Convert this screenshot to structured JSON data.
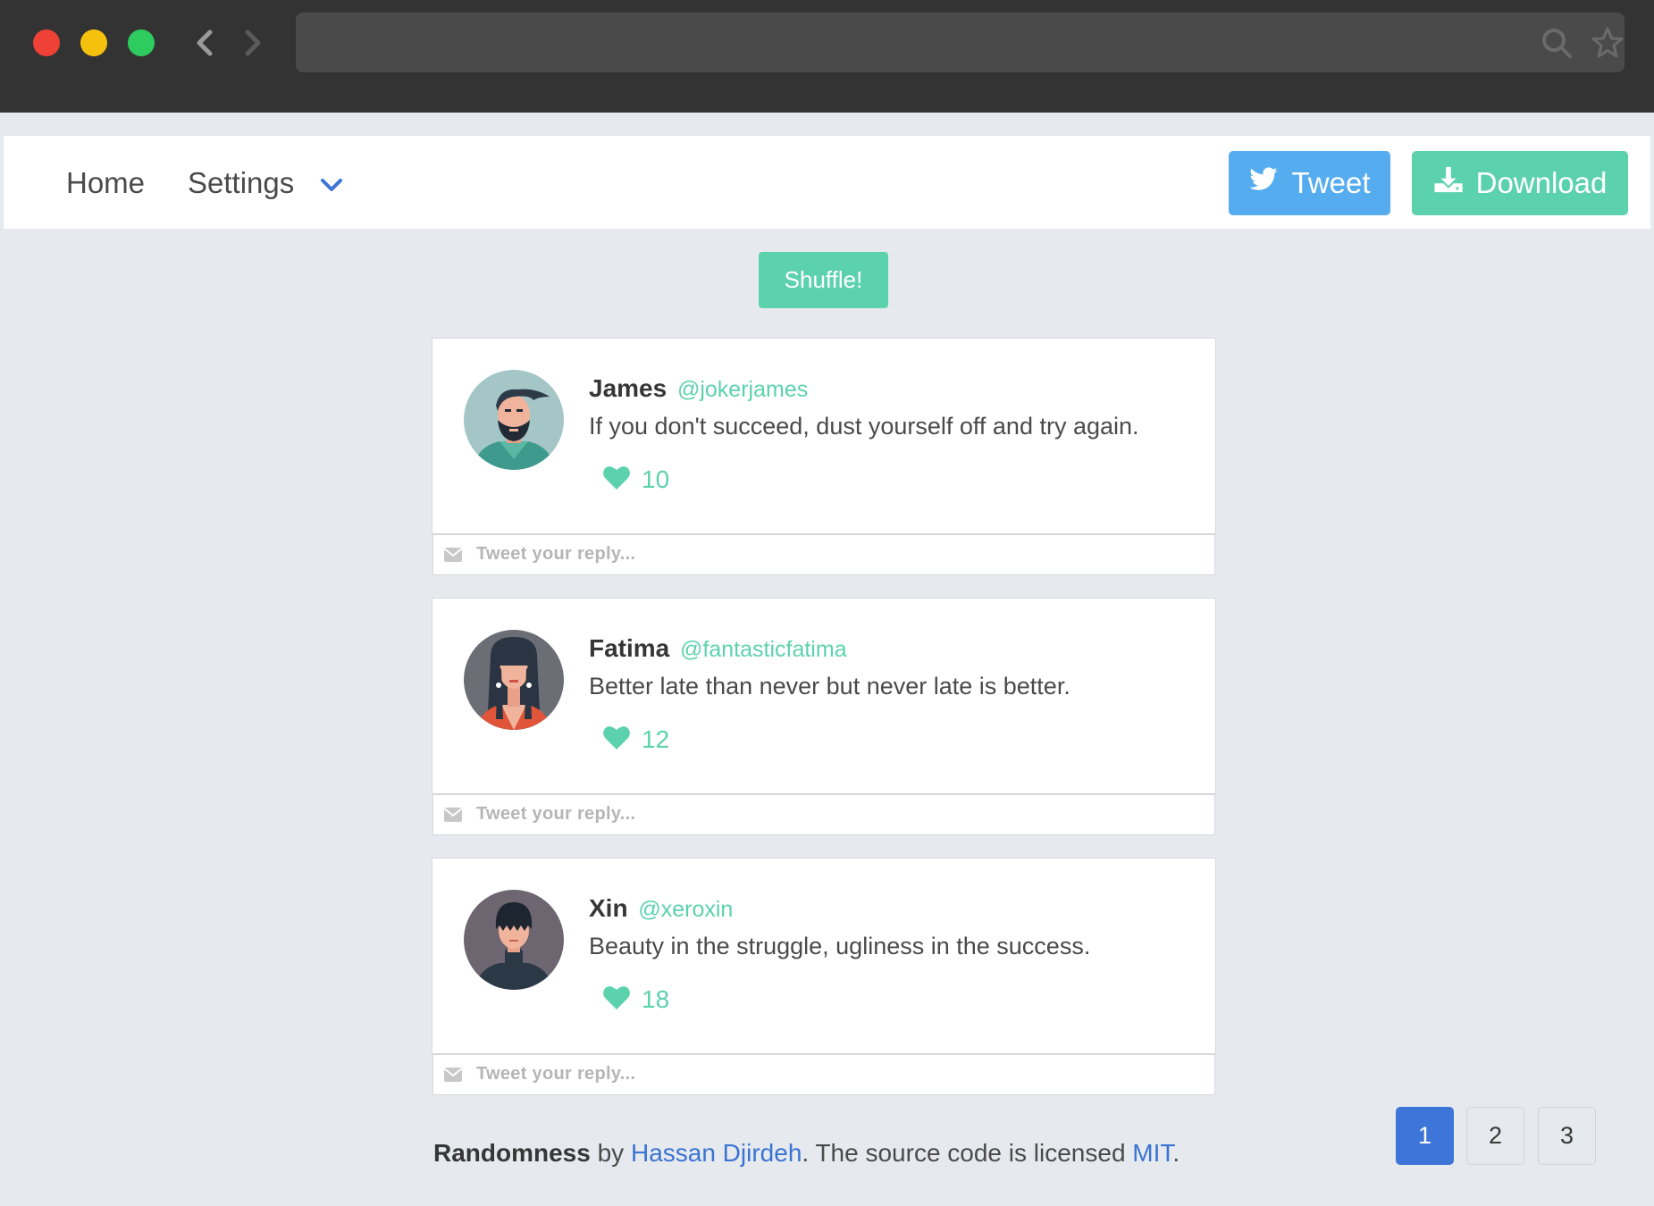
{
  "colors": {
    "accent_teal": "#5cd2ac",
    "twitter_blue": "#55acee",
    "link_blue": "#3b73d3",
    "page_bg": "#e6eaee"
  },
  "browser": {
    "back_icon": "chevron-left-icon",
    "forward_icon": "chevron-right-icon",
    "search_icon": "search-icon",
    "bookmark_icon": "star-icon"
  },
  "navbar": {
    "home_label": "Home",
    "settings_label": "Settings",
    "tweet_label": "Tweet",
    "download_label": "Download"
  },
  "shuffle_label": "Shuffle!",
  "tweets": [
    {
      "name": "James",
      "handle": "@jokerjames",
      "text": "If you don't succeed, dust yourself off and try again.",
      "likes": "10",
      "reply_placeholder": "Tweet your reply..."
    },
    {
      "name": "Fatima",
      "handle": "@fantasticfatima",
      "text": "Better late than never but never late is better.",
      "likes": "12",
      "reply_placeholder": "Tweet your reply..."
    },
    {
      "name": "Xin",
      "handle": "@xeroxin",
      "text": "Beauty in the struggle, ugliness in the success.",
      "likes": "18",
      "reply_placeholder": "Tweet your reply..."
    }
  ],
  "footer": {
    "project": "Randomness",
    "by": " by ",
    "author": "Hassan Djirdeh",
    "middle": ". The source code is licensed ",
    "license": "MIT",
    "end": "."
  },
  "pagination": [
    "1",
    "2",
    "3"
  ],
  "current_page": "1"
}
